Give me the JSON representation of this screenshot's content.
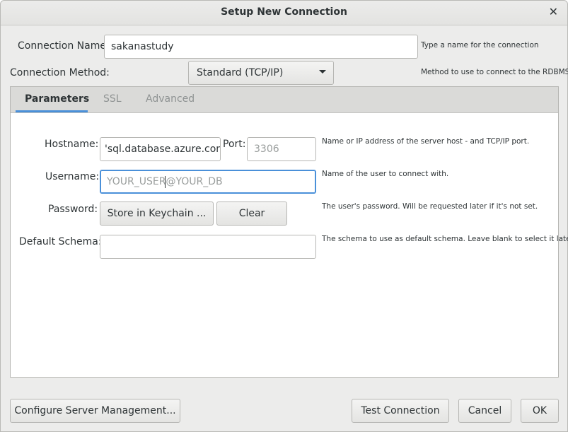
{
  "dialog": {
    "title": "Setup New Connection",
    "close_glyph": "✕"
  },
  "connection_name": {
    "label": "Connection Name:",
    "value": "sakanastudy",
    "hint": "Type a name for the connection"
  },
  "connection_method": {
    "label": "Connection Method:",
    "selected": "Standard (TCP/IP)",
    "hint": "Method to use to connect to the RDBMS"
  },
  "tabs": [
    {
      "label": "Parameters",
      "active": true
    },
    {
      "label": "SSL",
      "active": false
    },
    {
      "label": "Advanced",
      "active": false
    }
  ],
  "parameters": {
    "hostname": {
      "label": "Hostname:",
      "value": "'sql.database.azure.com"
    },
    "port": {
      "label": "Port:",
      "placeholder": "3306",
      "hint": "Name or IP address of the server host - and TCP/IP port."
    },
    "username": {
      "label": "Username:",
      "placeholder": "YOUR_USER@YOUR_DB",
      "hint": "Name of the user to connect with."
    },
    "password": {
      "label": "Password:",
      "store_button": "Store in Keychain ...",
      "clear_button": "Clear",
      "hint": "The user's password. Will be requested later if it's not set."
    },
    "default_schema": {
      "label": "Default Schema:",
      "value": "",
      "hint": "The schema to use as default schema. Leave blank to select it later."
    }
  },
  "footer": {
    "configure_button": "Configure Server Management...",
    "test_button": "Test Connection",
    "cancel_button": "Cancel",
    "ok_button": "OK"
  },
  "colors": {
    "focus_accent": "#4a90d9",
    "window_bg": "#ececeb",
    "panel_bg": "#ffffff"
  }
}
